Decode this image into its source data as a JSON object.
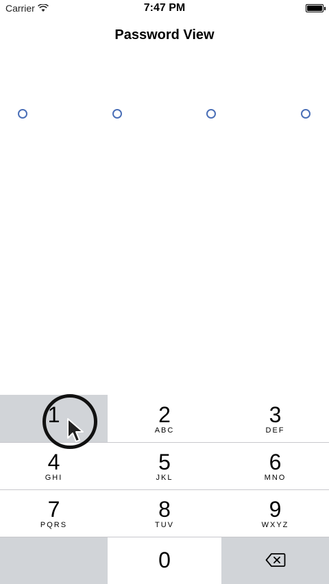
{
  "status_bar": {
    "carrier": "Carrier",
    "time": "7:47 PM"
  },
  "nav": {
    "title": "Password View"
  },
  "passcode": {
    "length": 4,
    "filled": 0,
    "dot_color": "#4a6fb7"
  },
  "keypad": {
    "keys": [
      {
        "digit": "1",
        "letters": ""
      },
      {
        "digit": "2",
        "letters": "ABC"
      },
      {
        "digit": "3",
        "letters": "DEF"
      },
      {
        "digit": "4",
        "letters": "GHI"
      },
      {
        "digit": "5",
        "letters": "JKL"
      },
      {
        "digit": "6",
        "letters": "MNO"
      },
      {
        "digit": "7",
        "letters": "PQRS"
      },
      {
        "digit": "8",
        "letters": "TUV"
      },
      {
        "digit": "9",
        "letters": "WXYZ"
      },
      {
        "digit": "0",
        "letters": ""
      }
    ],
    "delete_icon": "backspace-icon",
    "pressed_key": "1",
    "gray_color": "#d1d4d8"
  }
}
